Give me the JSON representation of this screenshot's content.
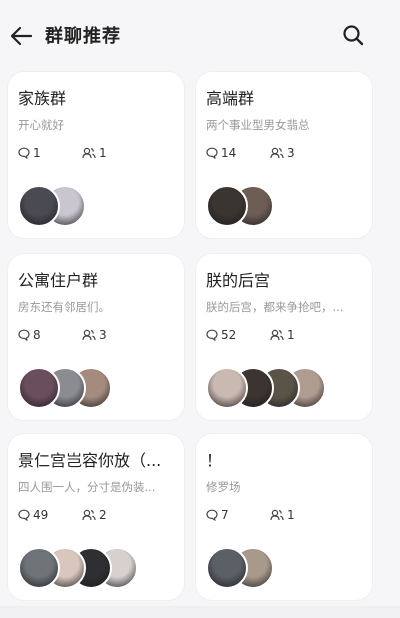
{
  "header": {
    "title": "群聊推荐",
    "back_icon": "arrow-left-icon",
    "search_icon": "search-icon"
  },
  "groups": [
    {
      "name": "家族群",
      "desc": "开心就好",
      "messages": "1",
      "members": "1",
      "avatars": [
        "#4a4a52",
        "#c9c6cf"
      ]
    },
    {
      "name": "高端群",
      "desc": "两个事业型男女翡总",
      "messages": "14",
      "members": "3",
      "avatars": [
        "#3a3530",
        "#6e5d55"
      ]
    },
    {
      "name": "公寓住户群",
      "desc": "房东还有邻居们。",
      "messages": "8",
      "members": "3",
      "avatars": [
        "#6b4e5c",
        "#8b8c92",
        "#a58b7e"
      ]
    },
    {
      "name": "朕的后宫",
      "desc": "朕的后宫，都来争抢吧，...",
      "messages": "52",
      "members": "1",
      "avatars": [
        "#c9b9b0",
        "#3c3431",
        "#5a5448",
        "#b19c90"
      ]
    },
    {
      "name": "景仁宫岂容你放（...",
      "desc": "四人围一人，分寸是伪装...",
      "messages": "49",
      "members": "2",
      "avatars": [
        "#6e7378",
        "#d9c7bd",
        "#2f2e33",
        "#d8cfcf"
      ]
    },
    {
      "name": "！",
      "desc": "修罗场",
      "messages": "7",
      "members": "1",
      "avatars": [
        "#5b5f66",
        "#a89a8a"
      ]
    }
  ]
}
